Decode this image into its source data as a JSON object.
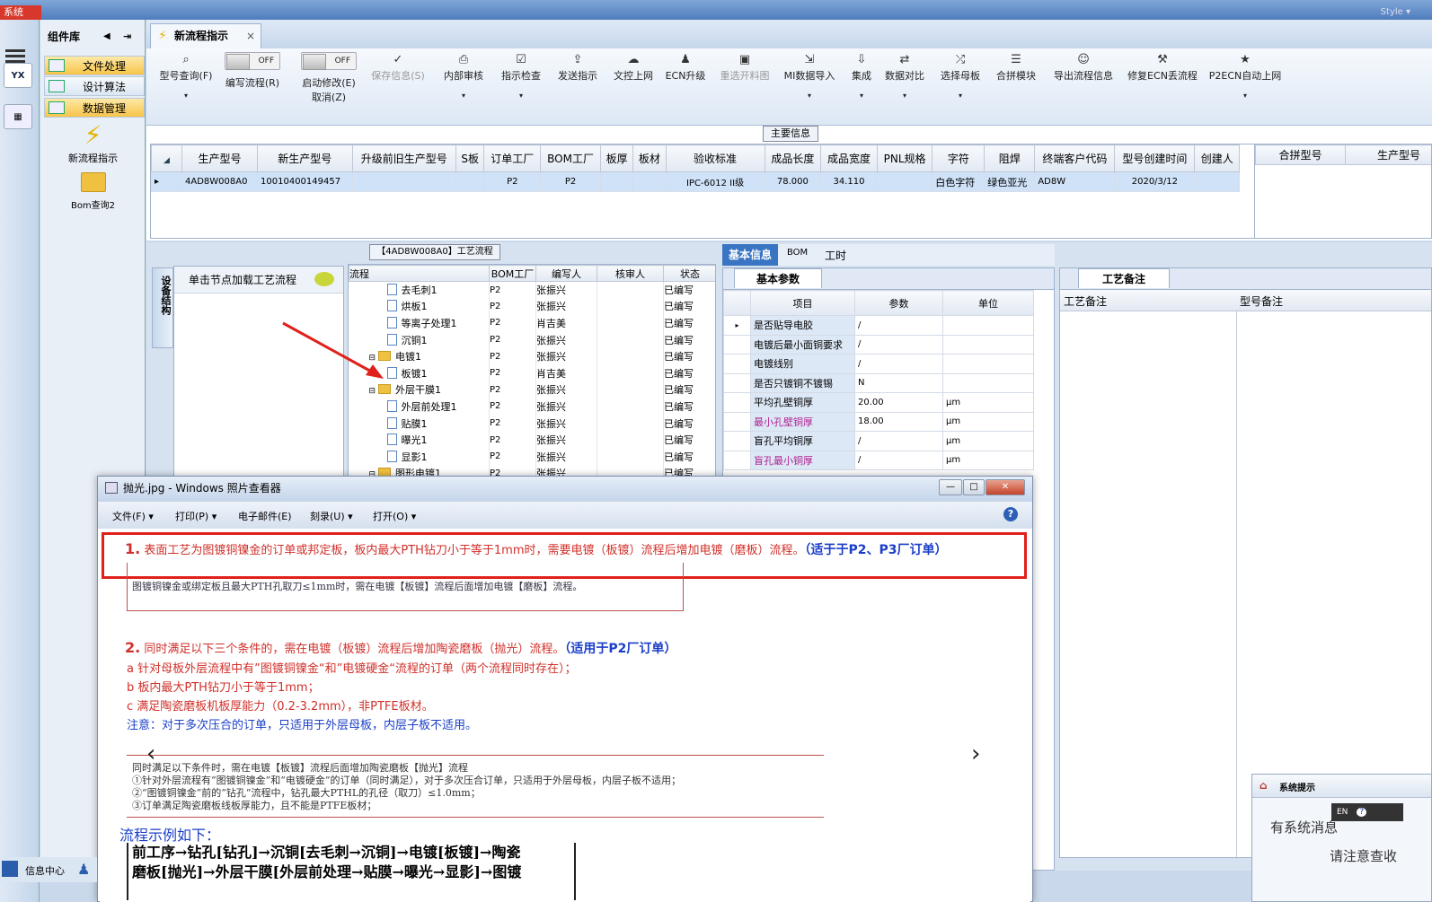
{
  "topbar": {
    "system_tab": "系统",
    "style_label": "Style ▾"
  },
  "left_panel": {
    "title": "组件库",
    "nav": [
      "文件处理",
      "设计算法",
      "数据管理"
    ],
    "big_items": [
      "新流程指示",
      "Bom查询2"
    ]
  },
  "document_tab": {
    "label": "新流程指示",
    "close": "×"
  },
  "toolbar": {
    "items": [
      {
        "label": "型号查询(F)",
        "icon": "search-icon"
      },
      {
        "label": "编写流程(R)",
        "toggle": "OFF"
      },
      {
        "label": "启动修改(E) 取消(Z)",
        "toggle": "OFF"
      },
      {
        "label": "保存信息(S)",
        "icon": "check-icon",
        "disabled": true
      },
      {
        "label": "内部审核",
        "icon": "print-icon"
      },
      {
        "label": "指示检查",
        "icon": "checkbox-icon"
      },
      {
        "label": "发送指示",
        "icon": "upload-icon"
      },
      {
        "label": "文控上网",
        "icon": "cloud-icon"
      },
      {
        "label": "ECN升级",
        "icon": "users-icon"
      },
      {
        "label": "重选开料图",
        "icon": "image-icon",
        "disabled": true
      },
      {
        "label": "MI数据导入",
        "icon": "import-icon"
      },
      {
        "label": "集成",
        "icon": "download-icon"
      },
      {
        "label": "数据对比",
        "icon": "compare-icon"
      },
      {
        "label": "选择母板",
        "icon": "shuffle-icon"
      },
      {
        "label": "合拼模块",
        "icon": "list-icon"
      },
      {
        "label": "导出流程信息",
        "icon": "smiley-icon"
      },
      {
        "label": "修复ECN丢流程",
        "icon": "wrench-icon"
      },
      {
        "label": "P2ECN自动上网",
        "icon": "star-icon"
      }
    ]
  },
  "main_info": {
    "title": "主要信息",
    "columns": [
      "生产型号",
      "新生产型号",
      "升级前旧生产型号",
      "S板",
      "订单工厂",
      "BOM工厂",
      "板厚",
      "板材",
      "验收标准",
      "成品长度",
      "成品宽度",
      "PNL规格",
      "字符",
      "阻焊",
      "终端客户代码",
      "型号创建时间",
      "创建人"
    ],
    "row": [
      "4AD8W008A0",
      "10010400149457",
      "",
      "",
      "P2",
      "P2",
      "",
      "",
      "IPC-6012 II级",
      "78.000",
      "34.110",
      "",
      "白色字符",
      "绿色亚光",
      "AD8W",
      "2020/3/12",
      ""
    ],
    "right_columns": [
      "合拼型号",
      "生产型号"
    ]
  },
  "process": {
    "title": "【4AD8W008A0】工艺流程",
    "side_tab": "设备结构",
    "hint": "单击节点加载工艺流程",
    "columns": [
      "流程",
      "BOM工厂",
      "编写人",
      "核审人",
      "状态"
    ],
    "rows": [
      {
        "name": "去毛刺1",
        "folder": false,
        "factory": "P2",
        "writer": "张振兴",
        "status": "已编写"
      },
      {
        "name": "烘板1",
        "folder": false,
        "factory": "P2",
        "writer": "张振兴",
        "status": "已编写"
      },
      {
        "name": "等离子处理1",
        "folder": false,
        "factory": "P2",
        "writer": "肖吉美",
        "status": "已编写"
      },
      {
        "name": "沉铜1",
        "folder": false,
        "factory": "P2",
        "writer": "张振兴",
        "status": "已编写"
      },
      {
        "name": "电镀1",
        "folder": true,
        "factory": "P2",
        "writer": "张振兴",
        "status": "已编写"
      },
      {
        "name": "板镀1",
        "folder": false,
        "factory": "P2",
        "writer": "肖吉美",
        "status": "已编写"
      },
      {
        "name": "外层干膜1",
        "folder": true,
        "factory": "P2",
        "writer": "张振兴",
        "status": "已编写"
      },
      {
        "name": "外层前处理1",
        "folder": false,
        "factory": "P2",
        "writer": "张振兴",
        "status": "已编写"
      },
      {
        "name": "贴膜1",
        "folder": false,
        "factory": "P2",
        "writer": "张振兴",
        "status": "已编写"
      },
      {
        "name": "曝光1",
        "folder": false,
        "factory": "P2",
        "writer": "张振兴",
        "status": "已编写"
      },
      {
        "name": "显影1",
        "folder": false,
        "factory": "P2",
        "writer": "张振兴",
        "status": "已编写"
      },
      {
        "name": "图形电镀1",
        "folder": true,
        "factory": "P2",
        "writer": "张振兴",
        "status": "已编写"
      }
    ]
  },
  "basic": {
    "tabs": [
      "基本信息",
      "BOM",
      "工时"
    ],
    "subtab": "基本参数",
    "columns": [
      "项目",
      "参数",
      "单位"
    ],
    "rows": [
      {
        "item": "是否贴导电胶",
        "param": "/",
        "unit": "",
        "pink": false
      },
      {
        "item": "电镀后最小面铜要求",
        "param": "/",
        "unit": "",
        "pink": false
      },
      {
        "item": "电镀线别",
        "param": "/",
        "unit": "",
        "pink": false
      },
      {
        "item": "是否只镀铜不镀锡",
        "param": "N",
        "unit": "",
        "pink": false
      },
      {
        "item": "平均孔壁铜厚",
        "param": "20.00",
        "unit": "μm",
        "pink": false
      },
      {
        "item": "最小孔壁铜厚",
        "param": "18.00",
        "unit": "μm",
        "pink": true
      },
      {
        "item": "盲孔平均铜厚",
        "param": "/",
        "unit": "μm",
        "pink": false
      },
      {
        "item": "盲孔最小铜厚",
        "param": "/",
        "unit": "μm",
        "pink": true
      }
    ]
  },
  "craft": {
    "tab": "工艺备注",
    "columns": [
      "工艺备注",
      "型号备注"
    ]
  },
  "viewer": {
    "title": "抛光.jpg - Windows 照片查看器",
    "menu": [
      "文件(F) ▾",
      "打印(P) ▾",
      "电子邮件(E)",
      "刻录(U) ▾",
      "打开(O) ▾"
    ],
    "help": "?",
    "controls": [
      "—",
      "□",
      "✕"
    ],
    "note1": {
      "num": "1.",
      "text": "表面工艺为图镀铜镍金的订单或邦定板，板内最大PTH钻刀小于等于1mm时，需要电镀（板镀）流程后增加电镀（磨板）流程。",
      "scope": "（适于于P2、P3厂订单）"
    },
    "old1": "图镀铜镍金或绑定板且最大PTH孔取刀≤1mm时，需在电镀【板镀】流程后面增加电镀【磨板】流程。",
    "note2": {
      "num": "2.",
      "text": "同时满足以下三个条件的，需在电镀（板镀）流程后增加陶瓷磨板（抛光）流程。",
      "scope": "（适用于P2厂订单）"
    },
    "cond_a": "a  针对母板外层流程中有”图镀铜镍金“和”电镀硬金“流程的订单（两个流程同时存在）；",
    "cond_b": "b  板内最大PTH钻刀小于等于1mm；",
    "cond_c": "c  满足陶瓷磨板机板厚能力（0.2-3.2mm），非PTFE板材。",
    "note_extra": "注意：对于多次压合的订单，只适用于外层母板，内层子板不适用。",
    "old2": [
      "同时满足以下条件时，需在电镀【板镀】流程后面增加陶瓷磨板【抛光】流程",
      "①针对外层流程有“图镀铜镍金”和“电镀硬金”的订单（同时满足），对于多次压合订单，只适用于外层母板，内层子板不适用；",
      "②“图镀铜镍金”前的“钻孔”流程中，钻孔最大PTHL的孔径（取刀）≤1.0mm；",
      "③订单满足陶瓷磨板线板厚能力，且不能是PTFE板材；"
    ],
    "example_title": "流程示例如下：",
    "example": [
      "前工序→钻孔[钻孔]→沉铜[去毛刺→沉铜]→电镀[板镀]→陶瓷",
      "磨板[抛光]→外层干膜[外层前处理→贴膜→曝光→显影]→图镀"
    ]
  },
  "notification": {
    "title": "系统提示",
    "line1": "有系统消息",
    "line2": "请注意查收",
    "lang": "EN"
  },
  "bottom": {
    "label": "信息中心"
  },
  "colors": {
    "highlight_red": "#e0201a",
    "note_blue": "#1a3ec8",
    "select_row": "#cfe2f7"
  }
}
